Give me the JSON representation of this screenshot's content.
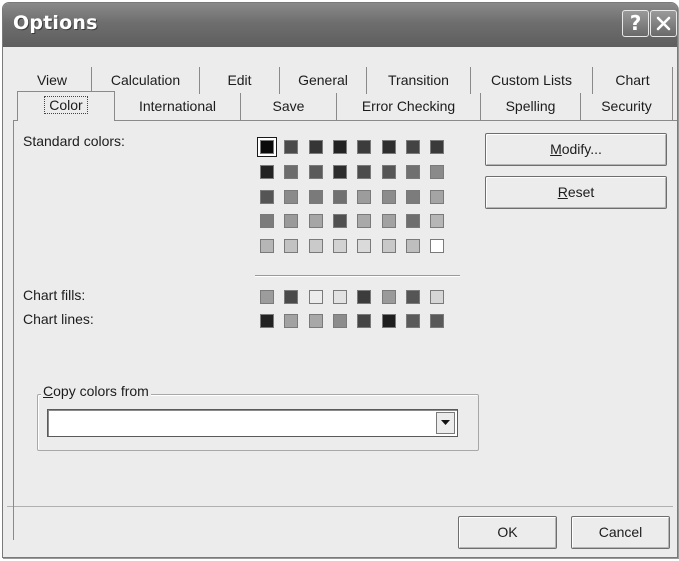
{
  "window": {
    "title": "Options"
  },
  "titlebar": {
    "help_label": "?"
  },
  "tabs": {
    "row1": [
      "View",
      "Calculation",
      "Edit",
      "General",
      "Transition",
      "Custom Lists",
      "Chart"
    ],
    "row2": [
      "Color",
      "International",
      "Save",
      "Error Checking",
      "Spelling",
      "Security"
    ],
    "selected": "Color"
  },
  "color_tab": {
    "standard_colors_label": "Standard colors:",
    "chart_fills_label": "Chart fills:",
    "chart_lines_label": "Chart lines:",
    "standard_colors": [
      [
        "#0a0a0a",
        "#4a4a4a",
        "#353535",
        "#222222",
        "#3c3c3c",
        "#2e2e2e",
        "#434343",
        "#3a3a3a"
      ],
      [
        "#222222",
        "#6c6c6c",
        "#5a5a5a",
        "#2c2c2c",
        "#4c4c4c",
        "#555555",
        "#707070",
        "#8a8a8a"
      ],
      [
        "#555555",
        "#8a8a8a",
        "#7a7a7a",
        "#707070",
        "#9c9c9c",
        "#8c8c8c",
        "#7c7c7c",
        "#a4a4a4"
      ],
      [
        "#7c7c7c",
        "#9a9a9a",
        "#a6a6a6",
        "#505050",
        "#a9a9a9",
        "#a2a2a2",
        "#6e6e6e",
        "#b6b6b6"
      ],
      [
        "#b6b6b6",
        "#c2c2c2",
        "#cacaca",
        "#d2d2d2",
        "#dadada",
        "#c8c8c8",
        "#bebebe",
        "#ffffff"
      ]
    ],
    "chart_fills": [
      "#9c9c9c",
      "#4a4a4a",
      "#ececec",
      "#e2e2e2",
      "#3c3c3c",
      "#9a9a9a",
      "#555555",
      "#d6d6d6"
    ],
    "chart_lines": [
      "#222222",
      "#a2a2a2",
      "#a8a8a8",
      "#8c8c8c",
      "#454545",
      "#1e1e1e",
      "#5a5a5a",
      "#595959"
    ],
    "selected_color_index": 0,
    "modify_button": {
      "prefix": "",
      "accel": "M",
      "suffix": "odify..."
    },
    "reset_button": {
      "prefix": "",
      "accel": "R",
      "suffix": "eset"
    },
    "copy_colors_group": {
      "accel": "C",
      "suffix": "opy colors from",
      "value": ""
    }
  },
  "footer": {
    "ok_label": "OK",
    "cancel_label": "Cancel"
  }
}
